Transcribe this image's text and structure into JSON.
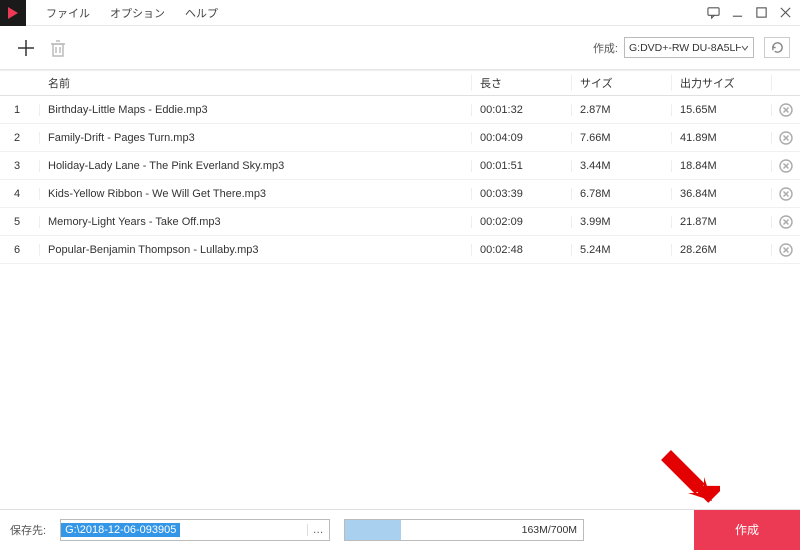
{
  "menu": {
    "file": "ファイル",
    "option": "オプション",
    "help": "ヘルプ"
  },
  "toolbar": {
    "drive_label": "作成:",
    "drive_value": "G:DVD+-RW DU-8A5LH"
  },
  "columns": {
    "name": "名前",
    "length": "長さ",
    "size": "サイズ",
    "output": "出力サイズ"
  },
  "rows": [
    {
      "idx": "1",
      "name": "Birthday-Little Maps - Eddie.mp3",
      "len": "00:01:32",
      "size": "2.87M",
      "out": "15.65M"
    },
    {
      "idx": "2",
      "name": "Family-Drift - Pages Turn.mp3",
      "len": "00:04:09",
      "size": "7.66M",
      "out": "41.89M"
    },
    {
      "idx": "3",
      "name": "Holiday-Lady Lane - The Pink Everland Sky.mp3",
      "len": "00:01:51",
      "size": "3.44M",
      "out": "18.84M"
    },
    {
      "idx": "4",
      "name": "Kids-Yellow Ribbon - We Will Get There.mp3",
      "len": "00:03:39",
      "size": "6.78M",
      "out": "36.84M"
    },
    {
      "idx": "5",
      "name": "Memory-Light Years - Take Off.mp3",
      "len": "00:02:09",
      "size": "3.99M",
      "out": "21.87M"
    },
    {
      "idx": "6",
      "name": "Popular-Benjamin Thompson - Lullaby.mp3",
      "len": "00:02:48",
      "size": "5.24M",
      "out": "28.26M"
    }
  ],
  "footer": {
    "save_label": "保存先:",
    "path": "G:\\2018-12-06-093905",
    "progress_text": "163M/700M",
    "progress_pct": 23.3,
    "create_label": "作成"
  }
}
